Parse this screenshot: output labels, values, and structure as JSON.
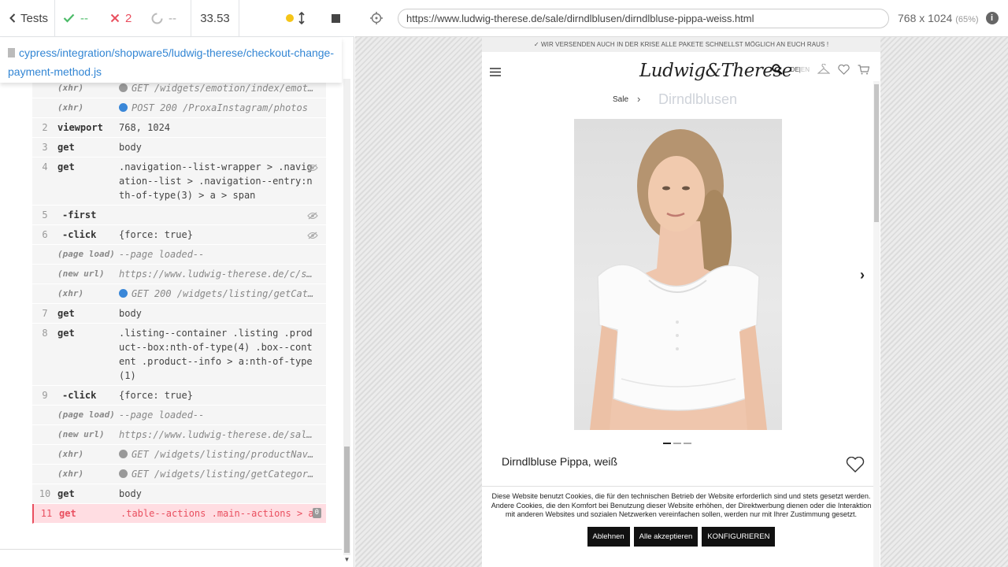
{
  "topbar": {
    "tests_label": "Tests",
    "passed": "--",
    "failed": "2",
    "pending": "--",
    "duration": "33.53"
  },
  "spec": {
    "path": "cypress/integration/shopware5/ludwig-therese/checkout-change-payment-method.js"
  },
  "commands": [
    {
      "num": "",
      "name": "(xhr)",
      "msg": "GET /widgets/emotion/index/emot…",
      "type": "event",
      "dot": "#999999"
    },
    {
      "num": "",
      "name": "(xhr)",
      "msg": "POST 200 /ProxaInstagram/photos",
      "type": "event",
      "dot": "#3a87d8"
    },
    {
      "num": "2",
      "name": "viewport",
      "msg": "768, 1024",
      "type": "cmd"
    },
    {
      "num": "3",
      "name": "get",
      "msg": "body",
      "type": "cmd"
    },
    {
      "num": "4",
      "name": "get",
      "msg": ".navigation--list-wrapper > .navigation--list > .navigation--entry:nth-of-type(3) > a > span",
      "type": "cmd",
      "eye": true
    },
    {
      "num": "5",
      "name": "-first",
      "msg": "",
      "type": "child",
      "eye": true
    },
    {
      "num": "6",
      "name": "-click",
      "msg": "{force: true}",
      "type": "child",
      "eye": true
    },
    {
      "num": "",
      "name": "(page load)",
      "msg": "--page loaded--",
      "type": "event"
    },
    {
      "num": "",
      "name": "(new url)",
      "msg": "https://www.ludwig-therese.de/c/sa…",
      "type": "event"
    },
    {
      "num": "",
      "name": "(xhr)",
      "msg": "GET 200 /widgets/listing/getCat…",
      "type": "event",
      "dot": "#3a87d8"
    },
    {
      "num": "7",
      "name": "get",
      "msg": "body",
      "type": "cmd"
    },
    {
      "num": "8",
      "name": "get",
      "msg": ".listing--container .listing .product--box:nth-of-type(4) .box--content .product--info > a:nth-of-type(1)",
      "type": "cmd"
    },
    {
      "num": "9",
      "name": "-click",
      "msg": "{force: true}",
      "type": "child"
    },
    {
      "num": "",
      "name": "(page load)",
      "msg": "--page loaded--",
      "type": "event"
    },
    {
      "num": "",
      "name": "(new url)",
      "msg": "https://www.ludwig-therese.de/sale…",
      "type": "event"
    },
    {
      "num": "",
      "name": "(xhr)",
      "msg": "GET /widgets/listing/productNav…",
      "type": "event",
      "dot": "#999999"
    },
    {
      "num": "",
      "name": "(xhr)",
      "msg": "GET /widgets/listing/getCategor…",
      "type": "event",
      "dot": "#999999"
    },
    {
      "num": "10",
      "name": "get",
      "msg": "body",
      "type": "cmd"
    },
    {
      "num": "11",
      "name": "get",
      "msg": ".table--actions .main--actions > a",
      "type": "err",
      "badge": "0"
    }
  ],
  "aut": {
    "url": "https://www.ludwig-therese.de/sale/dirndlblusen/dirndlbluse-pippa-weiss.html",
    "viewport": "768 x 1024",
    "scale": "(65%)"
  },
  "site": {
    "shipping_notice": "✓ WIR VERSENDEN AUCH IN DER KRISE ALLE PAKETE SCHNELLST MÖGLICH AN EUCH RAUS !",
    "logo": "Ludwig&Therese",
    "lang_de": "DE",
    "lang_sep": "|",
    "lang_en": "EN",
    "breadcrumb_sale": "Sale",
    "breadcrumb_category": "Dirndlblusen",
    "product_title": "Dirndlbluse Pippa, weiß",
    "cookie_text": "Diese Website benutzt Cookies, die für den technischen Betrieb der Website erforderlich sind und stets gesetzt werden. Andere Cookies, die den Komfort bei Benutzung dieser Website erhöhen, der Direktwerbung dienen oder die Interaktion mit anderen Websites und sozialen Netzwerken vereinfachen sollen, werden nur mit Ihrer Zustimmung gesetzt.",
    "btn_reject": "Ablehnen",
    "btn_accept_all": "Alle akzeptieren",
    "btn_configure": "KONFIGURIEREN"
  },
  "colors": {
    "pass": "#4cbb68",
    "fail": "#e94f5f",
    "link": "#3386d4"
  }
}
